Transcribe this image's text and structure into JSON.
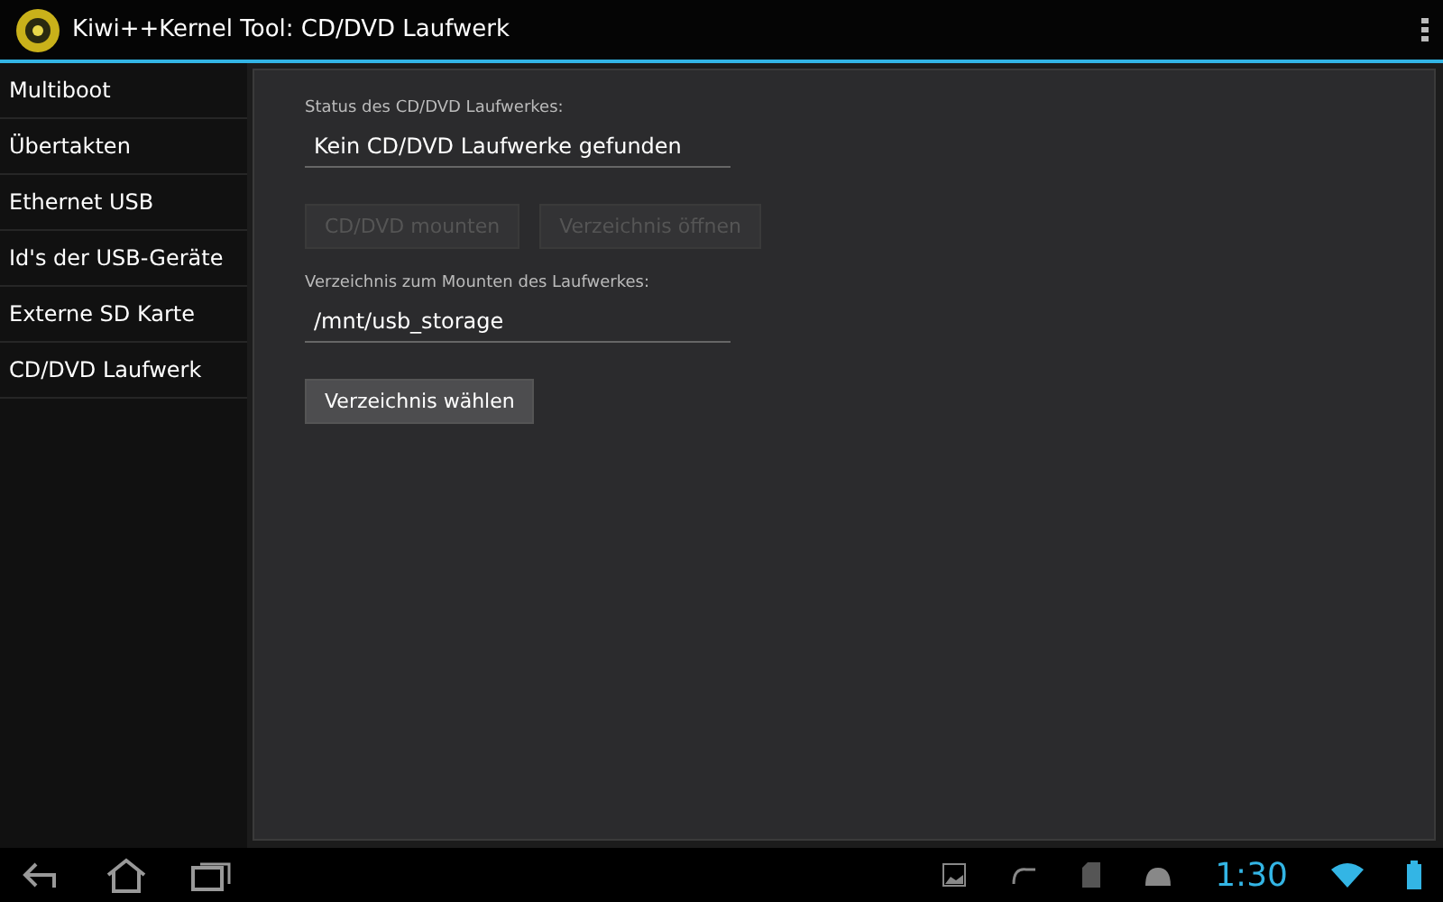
{
  "action_bar": {
    "title": "Kiwi++Kernel Tool: CD/DVD Laufwerk"
  },
  "sidebar": {
    "items": [
      {
        "label": "Multiboot"
      },
      {
        "label": "Übertakten"
      },
      {
        "label": "Ethernet USB"
      },
      {
        "label": "Id's der USB-Geräte"
      },
      {
        "label": "Externe SD Karte"
      },
      {
        "label": "CD/DVD Laufwerk"
      }
    ]
  },
  "content": {
    "status_label": "Status des CD/DVD Laufwerkes:",
    "status_value": "Kein CD/DVD Laufwerke gefunden",
    "status_buttons": [
      {
        "label": "CD/DVD mounten",
        "disabled": true
      },
      {
        "label": "Verzeichnis öffnen",
        "disabled": true
      }
    ],
    "dir_label": "Verzeichnis zum Mounten des Laufwerkes:",
    "dir_value": "/mnt/usb_storage",
    "dir_button": {
      "label": "Verzeichnis wählen",
      "disabled": false
    }
  },
  "system_bar": {
    "time": "1:30"
  }
}
